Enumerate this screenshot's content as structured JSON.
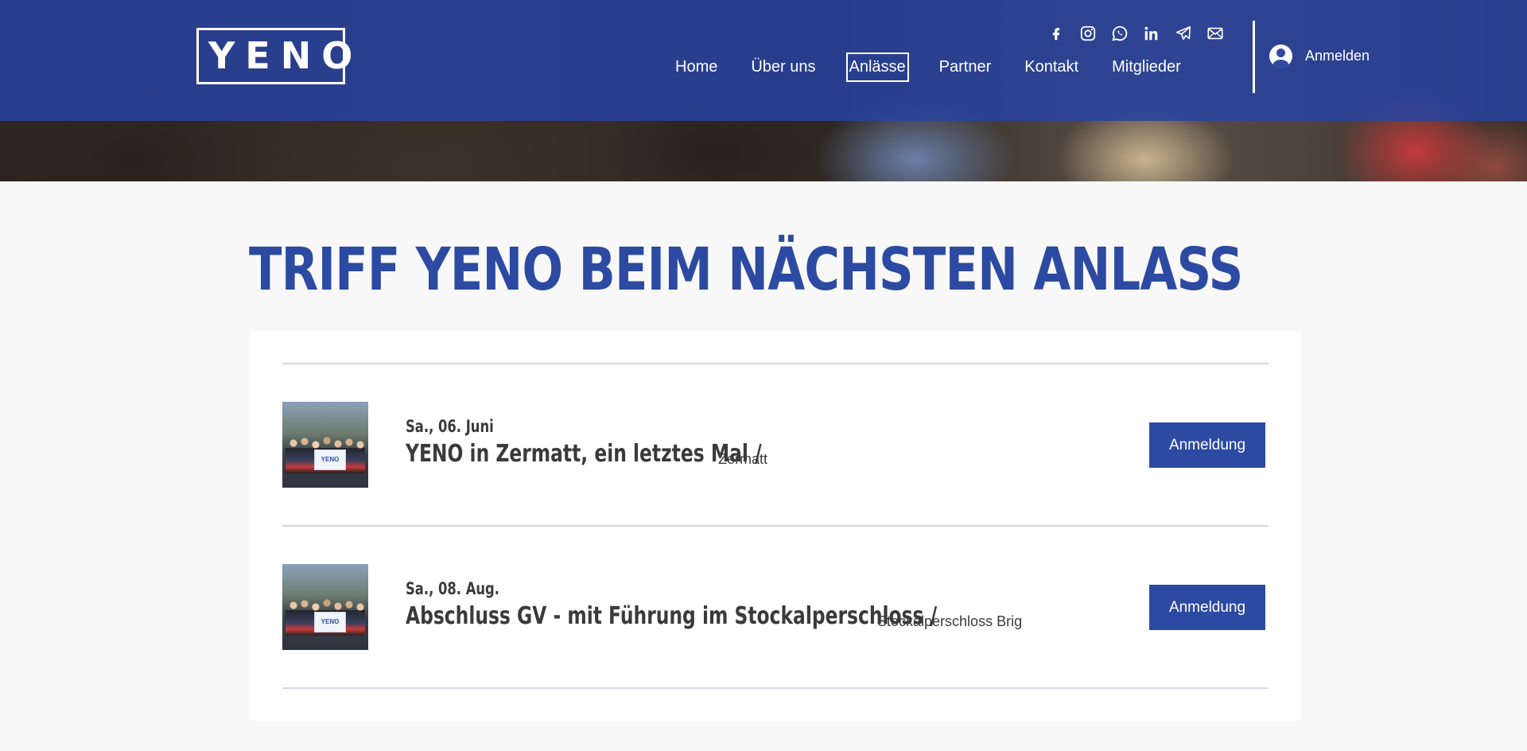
{
  "header": {
    "logo_text": "YENO",
    "social": [
      {
        "icon": "facebook-icon"
      },
      {
        "icon": "instagram-icon"
      },
      {
        "icon": "whatsapp-icon"
      },
      {
        "icon": "linkedin-icon"
      },
      {
        "icon": "telegram-icon"
      },
      {
        "icon": "mail-icon"
      }
    ],
    "nav": [
      {
        "label": "Home"
      },
      {
        "label": "Über uns"
      },
      {
        "label": "Anlässe",
        "active": true
      },
      {
        "label": "Partner"
      },
      {
        "label": "Kontakt"
      },
      {
        "label": "Mitglieder"
      }
    ],
    "login_label": "Anmelden"
  },
  "main": {
    "title": "TRIFF YENO BEIM NÄCHSTEN ANLASS",
    "events": [
      {
        "date": "Sa., 06. Juni",
        "title": "YENO in Zermatt, ein letztes Mal /",
        "location": "Zermatt",
        "button_label": "Anmeldung",
        "thumb_banner": "YENO"
      },
      {
        "date": "Sa., 08. Aug.",
        "title": "Abschluss GV - mit Führung im Stockalperschloss /",
        "location": "Stockalperschloss Brig",
        "button_label": "Anmeldung",
        "thumb_banner": "YENO"
      }
    ]
  },
  "colors": {
    "brand_blue": "#2c4aa1",
    "nav_overlay": "#2842a0",
    "text_dark": "#3a3a3a"
  }
}
